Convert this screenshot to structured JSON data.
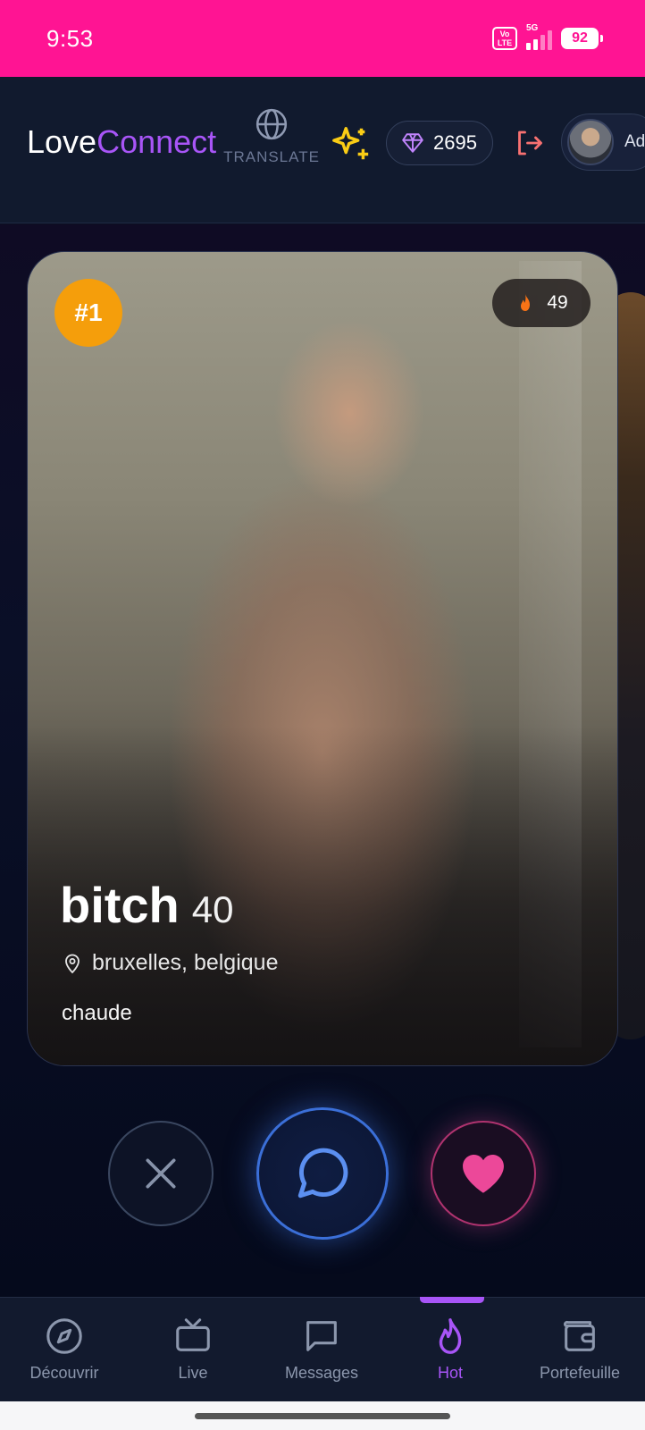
{
  "status_bar": {
    "time": "9:53",
    "network": "5G",
    "volte": "Vo LTE",
    "battery": "92"
  },
  "header": {
    "logo_part1": "Love",
    "logo_part2": "Connect",
    "translate_label": "TRANSLATE",
    "gems": "2695",
    "profile_name": "Ad"
  },
  "card": {
    "rank": "#1",
    "hot_count": "49",
    "name": "bitch",
    "age": "40",
    "location": "bruxelles, belgique",
    "bio": "chaude"
  },
  "nav": {
    "items": [
      {
        "label": "Découvrir",
        "icon": "compass-icon"
      },
      {
        "label": "Live",
        "icon": "tv-icon"
      },
      {
        "label": "Messages",
        "icon": "message-icon"
      },
      {
        "label": "Hot",
        "icon": "flame-icon",
        "active": true
      },
      {
        "label": "Portefeuille",
        "icon": "wallet-icon"
      }
    ]
  },
  "colors": {
    "status_bar": "#ff1493",
    "accent": "#a855f7",
    "rank_badge": "#f59e0b",
    "like": "#ec4899",
    "chat": "#3b6fd8"
  }
}
